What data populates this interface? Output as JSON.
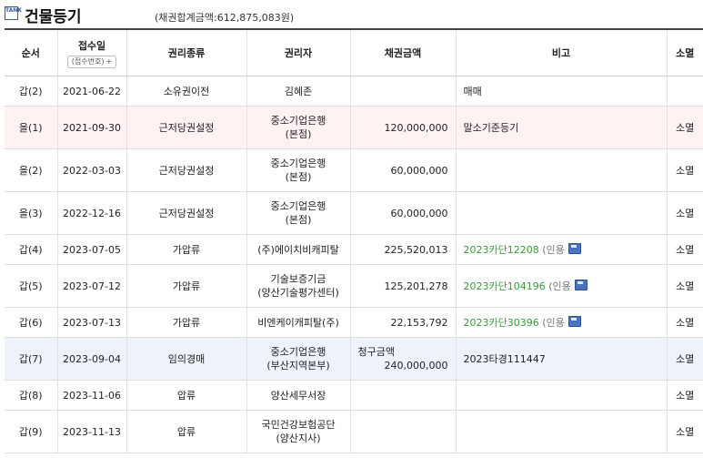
{
  "header": {
    "logo_text": "TANK",
    "title": "건물등기",
    "sum_text": "(채권합계금액:612,875,083원)"
  },
  "columns": {
    "order": "순서",
    "date": "접수일",
    "receipt_btn": "(접수번호)",
    "receipt_btn_plus": "+",
    "type": "권리종류",
    "holder": "권리자",
    "amount": "채권금액",
    "note": "비고",
    "cancel": "소멸"
  },
  "rows": [
    {
      "order": "갑(2)",
      "date": "2021-06-22",
      "type": "소유권이전",
      "holder1": "김혜존",
      "holder2": "",
      "claim_label": "",
      "amount": "",
      "note": "매매",
      "case": "",
      "inyong": "",
      "cancel": ""
    },
    {
      "order": "을(1)",
      "date": "2021-09-30",
      "type": "근저당권설정",
      "holder1": "중소기업은행",
      "holder2": "(본점)",
      "claim_label": "",
      "amount": "120,000,000",
      "note": "말소기준등기",
      "case": "",
      "inyong": "",
      "cancel": "소멸"
    },
    {
      "order": "을(2)",
      "date": "2022-03-03",
      "type": "근저당권설정",
      "holder1": "중소기업은행",
      "holder2": "(본점)",
      "claim_label": "",
      "amount": "60,000,000",
      "note": "",
      "case": "",
      "inyong": "",
      "cancel": "소멸"
    },
    {
      "order": "을(3)",
      "date": "2022-12-16",
      "type": "근저당권설정",
      "holder1": "중소기업은행",
      "holder2": "(본점)",
      "claim_label": "",
      "amount": "60,000,000",
      "note": "",
      "case": "",
      "inyong": "",
      "cancel": "소멸"
    },
    {
      "order": "갑(4)",
      "date": "2023-07-05",
      "type": "가압류",
      "holder1": "(주)에이치비캐피탈",
      "holder2": "",
      "claim_label": "",
      "amount": "225,520,013",
      "note": "",
      "case": "2023카단12208",
      "inyong": "(인용",
      "cancel": "소멸"
    },
    {
      "order": "갑(5)",
      "date": "2023-07-12",
      "type": "가압류",
      "holder1": "기술보증기금",
      "holder2": "(양산기술평가센터)",
      "claim_label": "",
      "amount": "125,201,278",
      "note": "",
      "case": "2023카단104196",
      "inyong": "(인용",
      "cancel": "소멸"
    },
    {
      "order": "갑(6)",
      "date": "2023-07-13",
      "type": "가압류",
      "holder1": "비엔케이캐피탈(주)",
      "holder2": "",
      "claim_label": "",
      "amount": "22,153,792",
      "note": "",
      "case": "2023카단30396",
      "inyong": "(인용",
      "cancel": "소멸"
    },
    {
      "order": "갑(7)",
      "date": "2023-09-04",
      "type": "임의경매",
      "holder1": "중소기업은행",
      "holder2": "(부산지역본부)",
      "claim_label": "청구금액",
      "amount": "240,000,000",
      "note": "2023타경111447",
      "case": "",
      "inyong": "",
      "cancel": "소멸"
    },
    {
      "order": "갑(8)",
      "date": "2023-11-06",
      "type": "압류",
      "holder1": "양산세무서장",
      "holder2": "",
      "claim_label": "",
      "amount": "",
      "note": "",
      "case": "",
      "inyong": "",
      "cancel": "소멸"
    },
    {
      "order": "갑(9)",
      "date": "2023-11-13",
      "type": "압류",
      "holder1": "국민건강보험공단",
      "holder2": "(양산지사)",
      "claim_label": "",
      "amount": "",
      "note": "",
      "case": "",
      "inyong": "",
      "cancel": "소멸"
    }
  ],
  "colors": {
    "pink_row": "#fff2f2",
    "blue_row": "#eef2fb",
    "case_link": "#3b9a3b"
  }
}
